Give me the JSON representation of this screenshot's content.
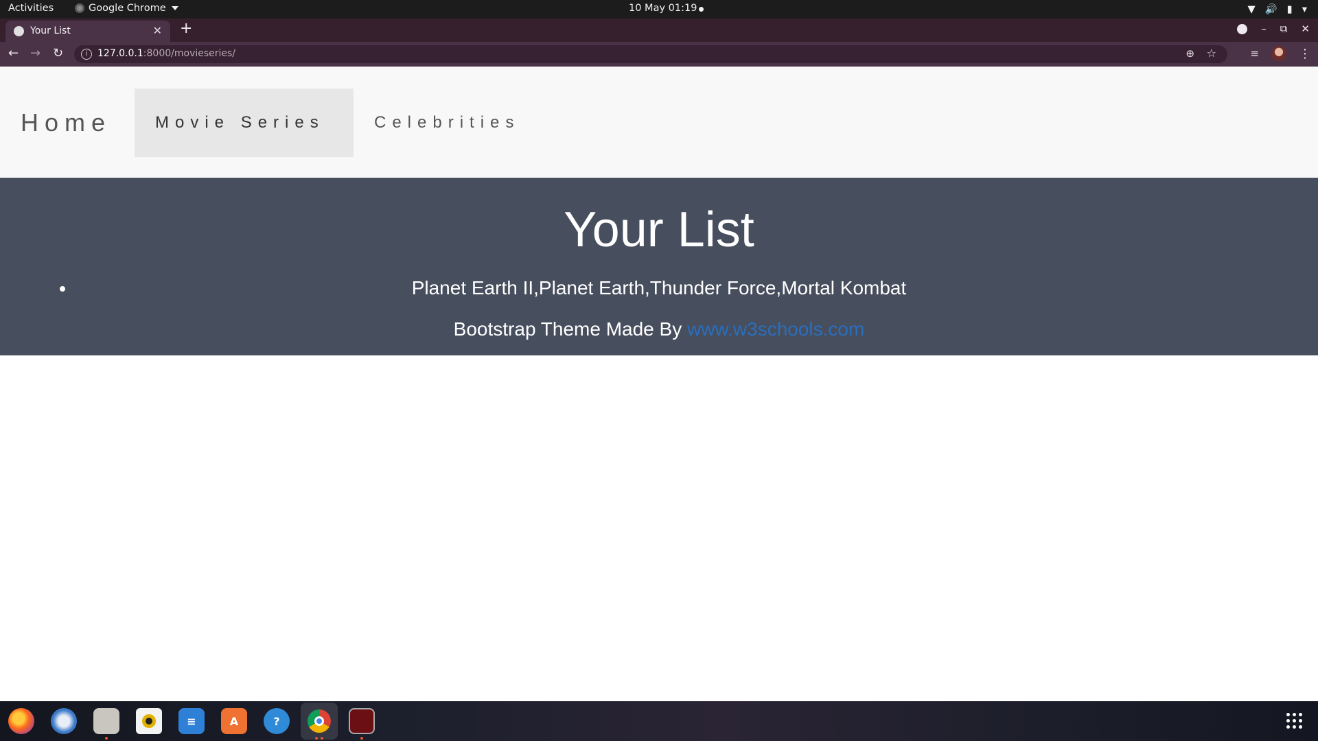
{
  "topbar": {
    "activities": "Activities",
    "app_name": "Google Chrome",
    "clock": "10 May  01:19"
  },
  "browser": {
    "tab_title": "Your List",
    "url_host": "127.0.0.1",
    "url_path": ":8000/movieseries/"
  },
  "navbar": {
    "home": "Home",
    "movie_series": "Movie Series",
    "celebrities": "Celebrities"
  },
  "content": {
    "heading": "Your List",
    "list_item": "Planet Earth II,Planet Earth,Thunder Force,Mortal Kombat",
    "credit_text": "Bootstrap Theme Made By ",
    "credit_link": "www.w3schools.com"
  },
  "dock": {
    "apps": [
      "firefox-icon",
      "thunderbird-icon",
      "files-icon",
      "rhythmbox-icon",
      "writer-icon",
      "software-icon",
      "help-icon",
      "chrome-icon",
      "terminal-icon"
    ]
  },
  "colors": {
    "navbar_bg": "#f8f8f8",
    "content_bg": "#474e5d",
    "link": "#2a6ebf",
    "active_nav_bg": "#e7e7e7"
  }
}
